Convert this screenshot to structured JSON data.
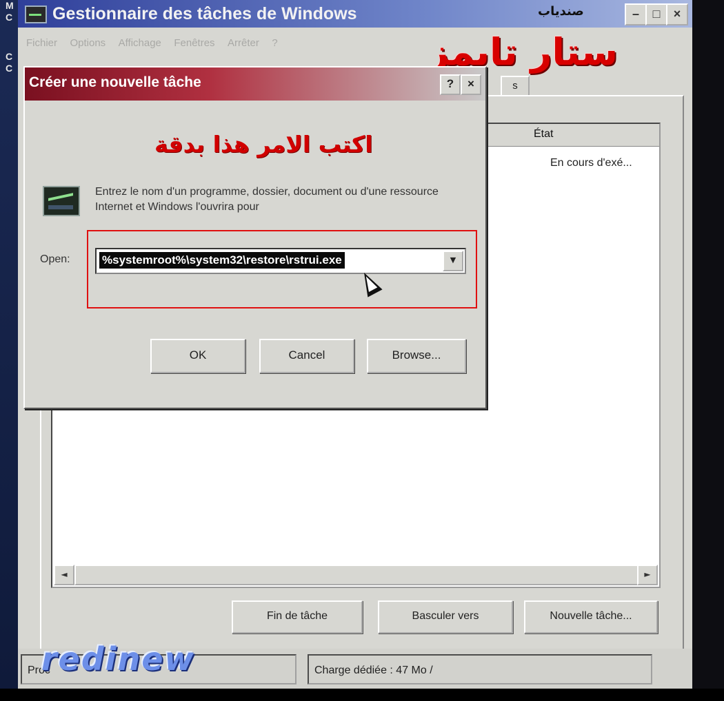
{
  "desktop": {
    "left_strip_letters": [
      "M",
      "C",
      "C",
      "C"
    ]
  },
  "task_manager": {
    "title": "Gestionnaire des tâches de Windows",
    "user_label": "صندیاب",
    "window_buttons": {
      "minimize": "–",
      "maximize": "□",
      "close": "×"
    },
    "menu": [
      "Fichier",
      "Options",
      "Affichage",
      "Fenêtres",
      "Arrêter",
      "?"
    ],
    "tab_partial": "s",
    "column_header": "État",
    "row_status": "En cours d'exé...",
    "scroll_left": "◄",
    "scroll_right": "►",
    "buttons": {
      "end_task": "Fin de tâche",
      "switch_to": "Basculer vers",
      "new_task": "Nouvelle tâche..."
    },
    "status_bar": {
      "processes": "Proc",
      "commit": "Charge dédiée : 47 Mo /"
    }
  },
  "overlay": {
    "site_logo": "ستار تايمز",
    "instruction": "اكتب الامر هذا بدقة",
    "watermark": "redinew"
  },
  "run_dialog": {
    "title": "Créer une nouvelle tâche",
    "help_button": "?",
    "close_button": "×",
    "description": "Entrez le nom d'un programme, dossier, document ou d'une ressource Internet et Windows l'ouvrira pour",
    "open_label": "Open:",
    "command_value": "%systemroot%\\system32\\restore\\rstrui.exe",
    "dropdown_arrow": "▼",
    "buttons": {
      "ok": "OK",
      "cancel": "Cancel",
      "browse": "Browse..."
    }
  },
  "colors": {
    "dialog_title_accent": "#8b1a2b",
    "window_title_accent": "#3a4ea8",
    "highlight_box": "#e01010",
    "overlay_text": "#d80000"
  }
}
